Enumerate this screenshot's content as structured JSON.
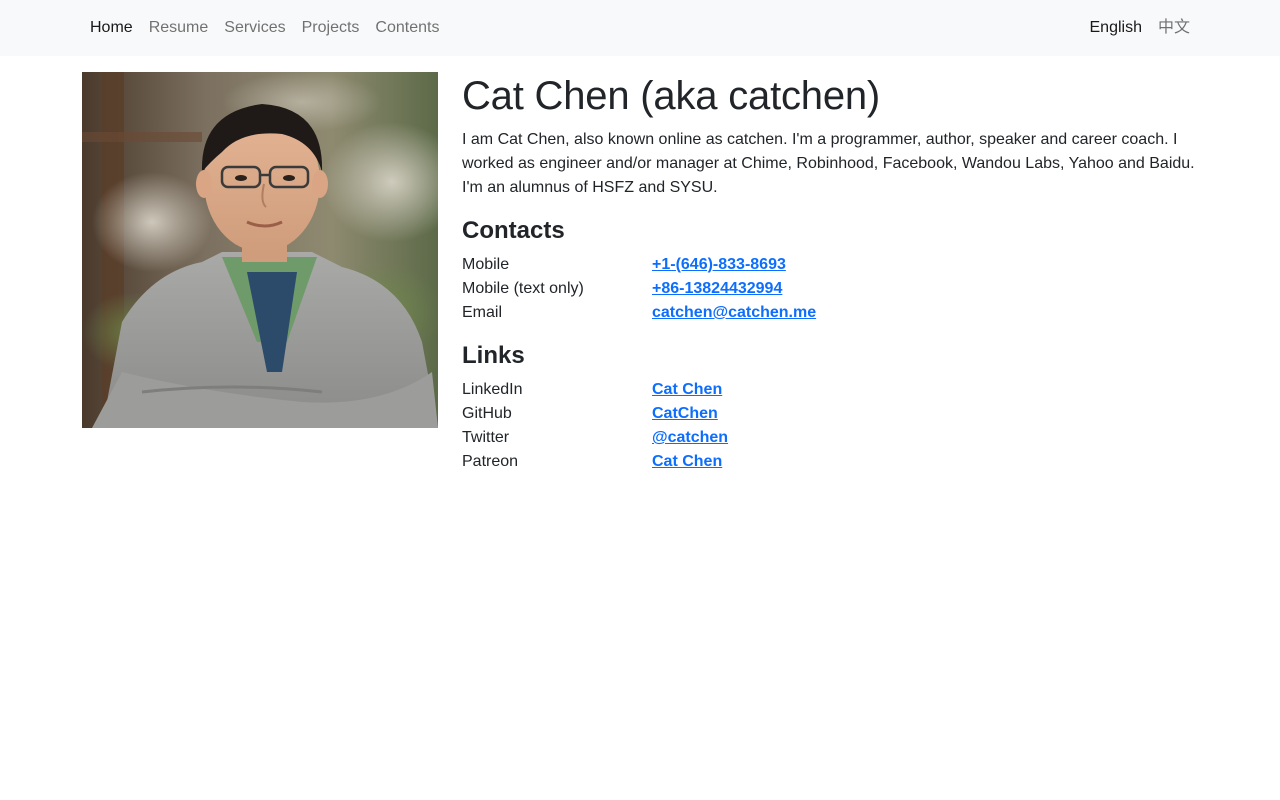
{
  "nav": {
    "items": [
      {
        "label": "Home"
      },
      {
        "label": "Resume"
      },
      {
        "label": "Services"
      },
      {
        "label": "Projects"
      },
      {
        "label": "Contents"
      }
    ],
    "languages": [
      {
        "label": "English"
      },
      {
        "label": "中文"
      }
    ]
  },
  "profile": {
    "title": "Cat Chen (aka catchen)",
    "intro": "I am Cat Chen, also known online as catchen. I'm a programmer, author, speaker and career coach. I worked as engineer and/or manager at Chime, Robinhood, Facebook, Wandou Labs, Yahoo and Baidu. I'm an alumnus of HSFZ and SYSU."
  },
  "contacts": {
    "heading": "Contacts",
    "rows": [
      {
        "label": "Mobile",
        "value": "+1-(646)-833-8693"
      },
      {
        "label": "Mobile (text only)",
        "value": "+86-13824432994"
      },
      {
        "label": "Email",
        "value": "catchen@catchen.me"
      }
    ]
  },
  "links": {
    "heading": "Links",
    "rows": [
      {
        "label": "LinkedIn",
        "value": "Cat Chen"
      },
      {
        "label": "GitHub",
        "value": "CatChen"
      },
      {
        "label": "Twitter",
        "value": "@catchen"
      },
      {
        "label": "Patreon",
        "value": "Cat Chen"
      }
    ]
  },
  "colors": {
    "navbar_bg": "#f8f9fa",
    "link": "#0d6efd",
    "text": "#212529"
  }
}
